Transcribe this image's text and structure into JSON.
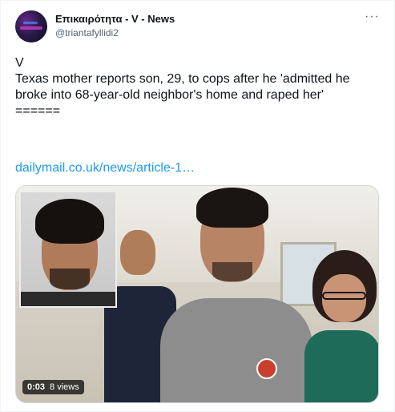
{
  "author": {
    "display_name": "Επικαιρότητα - V - News",
    "handle": "@triantafyllidi2"
  },
  "menu": {
    "more_label": "···"
  },
  "tweet": {
    "line1": "V",
    "line2": "Texas mother reports son, 29, to cops after he 'admitted he broke into 68-year-old neighbor's home and raped her'",
    "line3": "======",
    "link": "dailymail.co.uk/news/article-1…"
  },
  "media": {
    "duration": "0:03",
    "views": "8 views"
  }
}
